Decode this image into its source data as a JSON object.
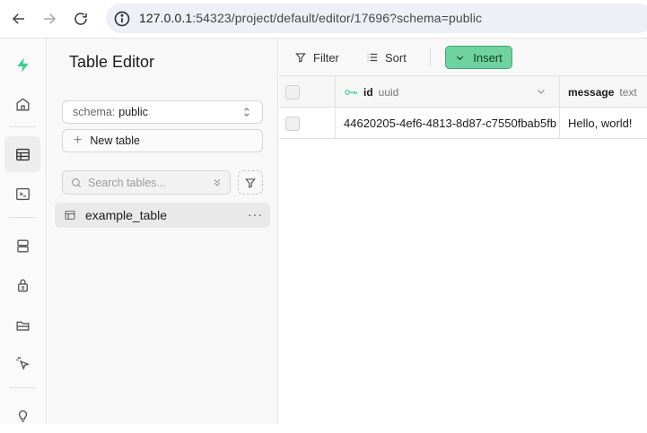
{
  "browser": {
    "url_host": "127.0.0.1",
    "url_path": ":54323/project/default/editor/17696?schema=public"
  },
  "rail": {
    "items": [
      {
        "icon": "supabase-logo-icon"
      },
      {
        "icon": "home-icon"
      },
      {
        "icon": "table-editor-icon",
        "active": true
      },
      {
        "icon": "sql-editor-icon"
      },
      {
        "icon": "database-icon"
      },
      {
        "icon": "auth-lock-icon"
      },
      {
        "icon": "storage-icon"
      },
      {
        "icon": "realtime-icon"
      },
      {
        "icon": "lightbulb-icon"
      }
    ]
  },
  "sidebar": {
    "title": "Table Editor",
    "schema_label": "schema:",
    "schema_value": "public",
    "new_table_label": "New table",
    "search_placeholder": "Search tables...",
    "tables": [
      {
        "name": "example_table",
        "selected": true
      }
    ]
  },
  "toolbar": {
    "filter_label": "Filter",
    "sort_label": "Sort",
    "insert_label": "Insert"
  },
  "grid": {
    "columns": [
      {
        "name": "id",
        "type": "uuid",
        "primary_key": true
      },
      {
        "name": "message",
        "type": "text"
      }
    ],
    "rows": [
      {
        "id": "44620205-4ef6-4813-8d87-c7550fbab5fb",
        "message": "Hello, world!"
      }
    ]
  },
  "colors": {
    "brand_green": "#3ecf8e",
    "insert_bg": "#6fd3a0"
  }
}
